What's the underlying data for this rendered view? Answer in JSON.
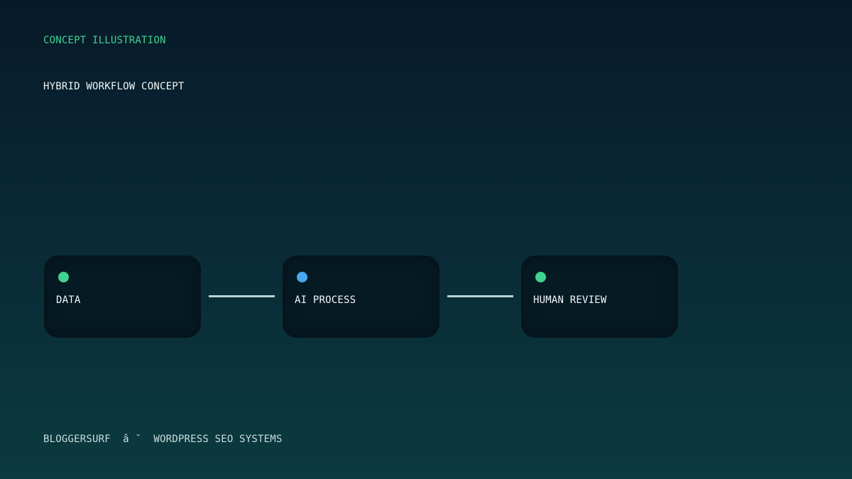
{
  "header": {
    "eyebrow": "CONCEPT ILLUSTRATION",
    "title": "HYBRID WORKFLOW CONCEPT"
  },
  "colors": {
    "green_dot": "#3fd38f",
    "blue_dot": "#4aa8f0",
    "connector": "#b9d3d3"
  },
  "nodes": [
    {
      "label": "DATA",
      "dot_color": "green"
    },
    {
      "label": "AI PROCESS",
      "dot_color": "blue"
    },
    {
      "label": "HUMAN REVIEW",
      "dot_color": "green"
    }
  ],
  "footer": {
    "text": "BLOGGERSURF  â ˘  WORDPRESS SEO SYSTEMS"
  }
}
